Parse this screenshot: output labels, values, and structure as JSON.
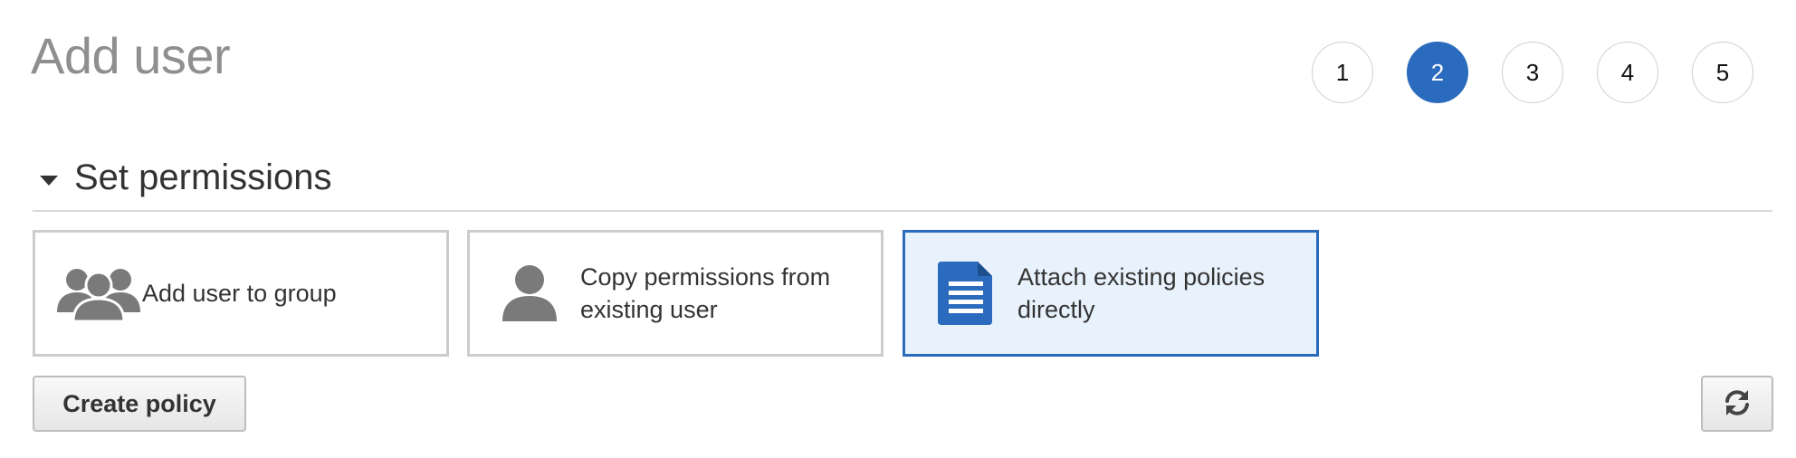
{
  "page": {
    "title": "Add user"
  },
  "steps": [
    {
      "label": "1",
      "active": false
    },
    {
      "label": "2",
      "active": true
    },
    {
      "label": "3",
      "active": false
    },
    {
      "label": "4",
      "active": false
    },
    {
      "label": "5",
      "active": false
    }
  ],
  "section": {
    "title": "Set permissions"
  },
  "options": [
    {
      "label": "Add user to group",
      "icon": "user-group-icon",
      "selected": false
    },
    {
      "label": "Copy permissions from existing user",
      "icon": "user-icon",
      "selected": false
    },
    {
      "label": "Attach existing policies directly",
      "icon": "document-icon",
      "selected": true
    }
  ],
  "actions": {
    "create_policy_label": "Create policy",
    "refresh_icon": "refresh-icon"
  },
  "colors": {
    "accent": "#2b6bbd",
    "selected_bg": "#e8f2fc",
    "title_gray": "#8f8f8f",
    "icon_gray": "#7a7a7a",
    "border_gray": "#cccccc"
  }
}
